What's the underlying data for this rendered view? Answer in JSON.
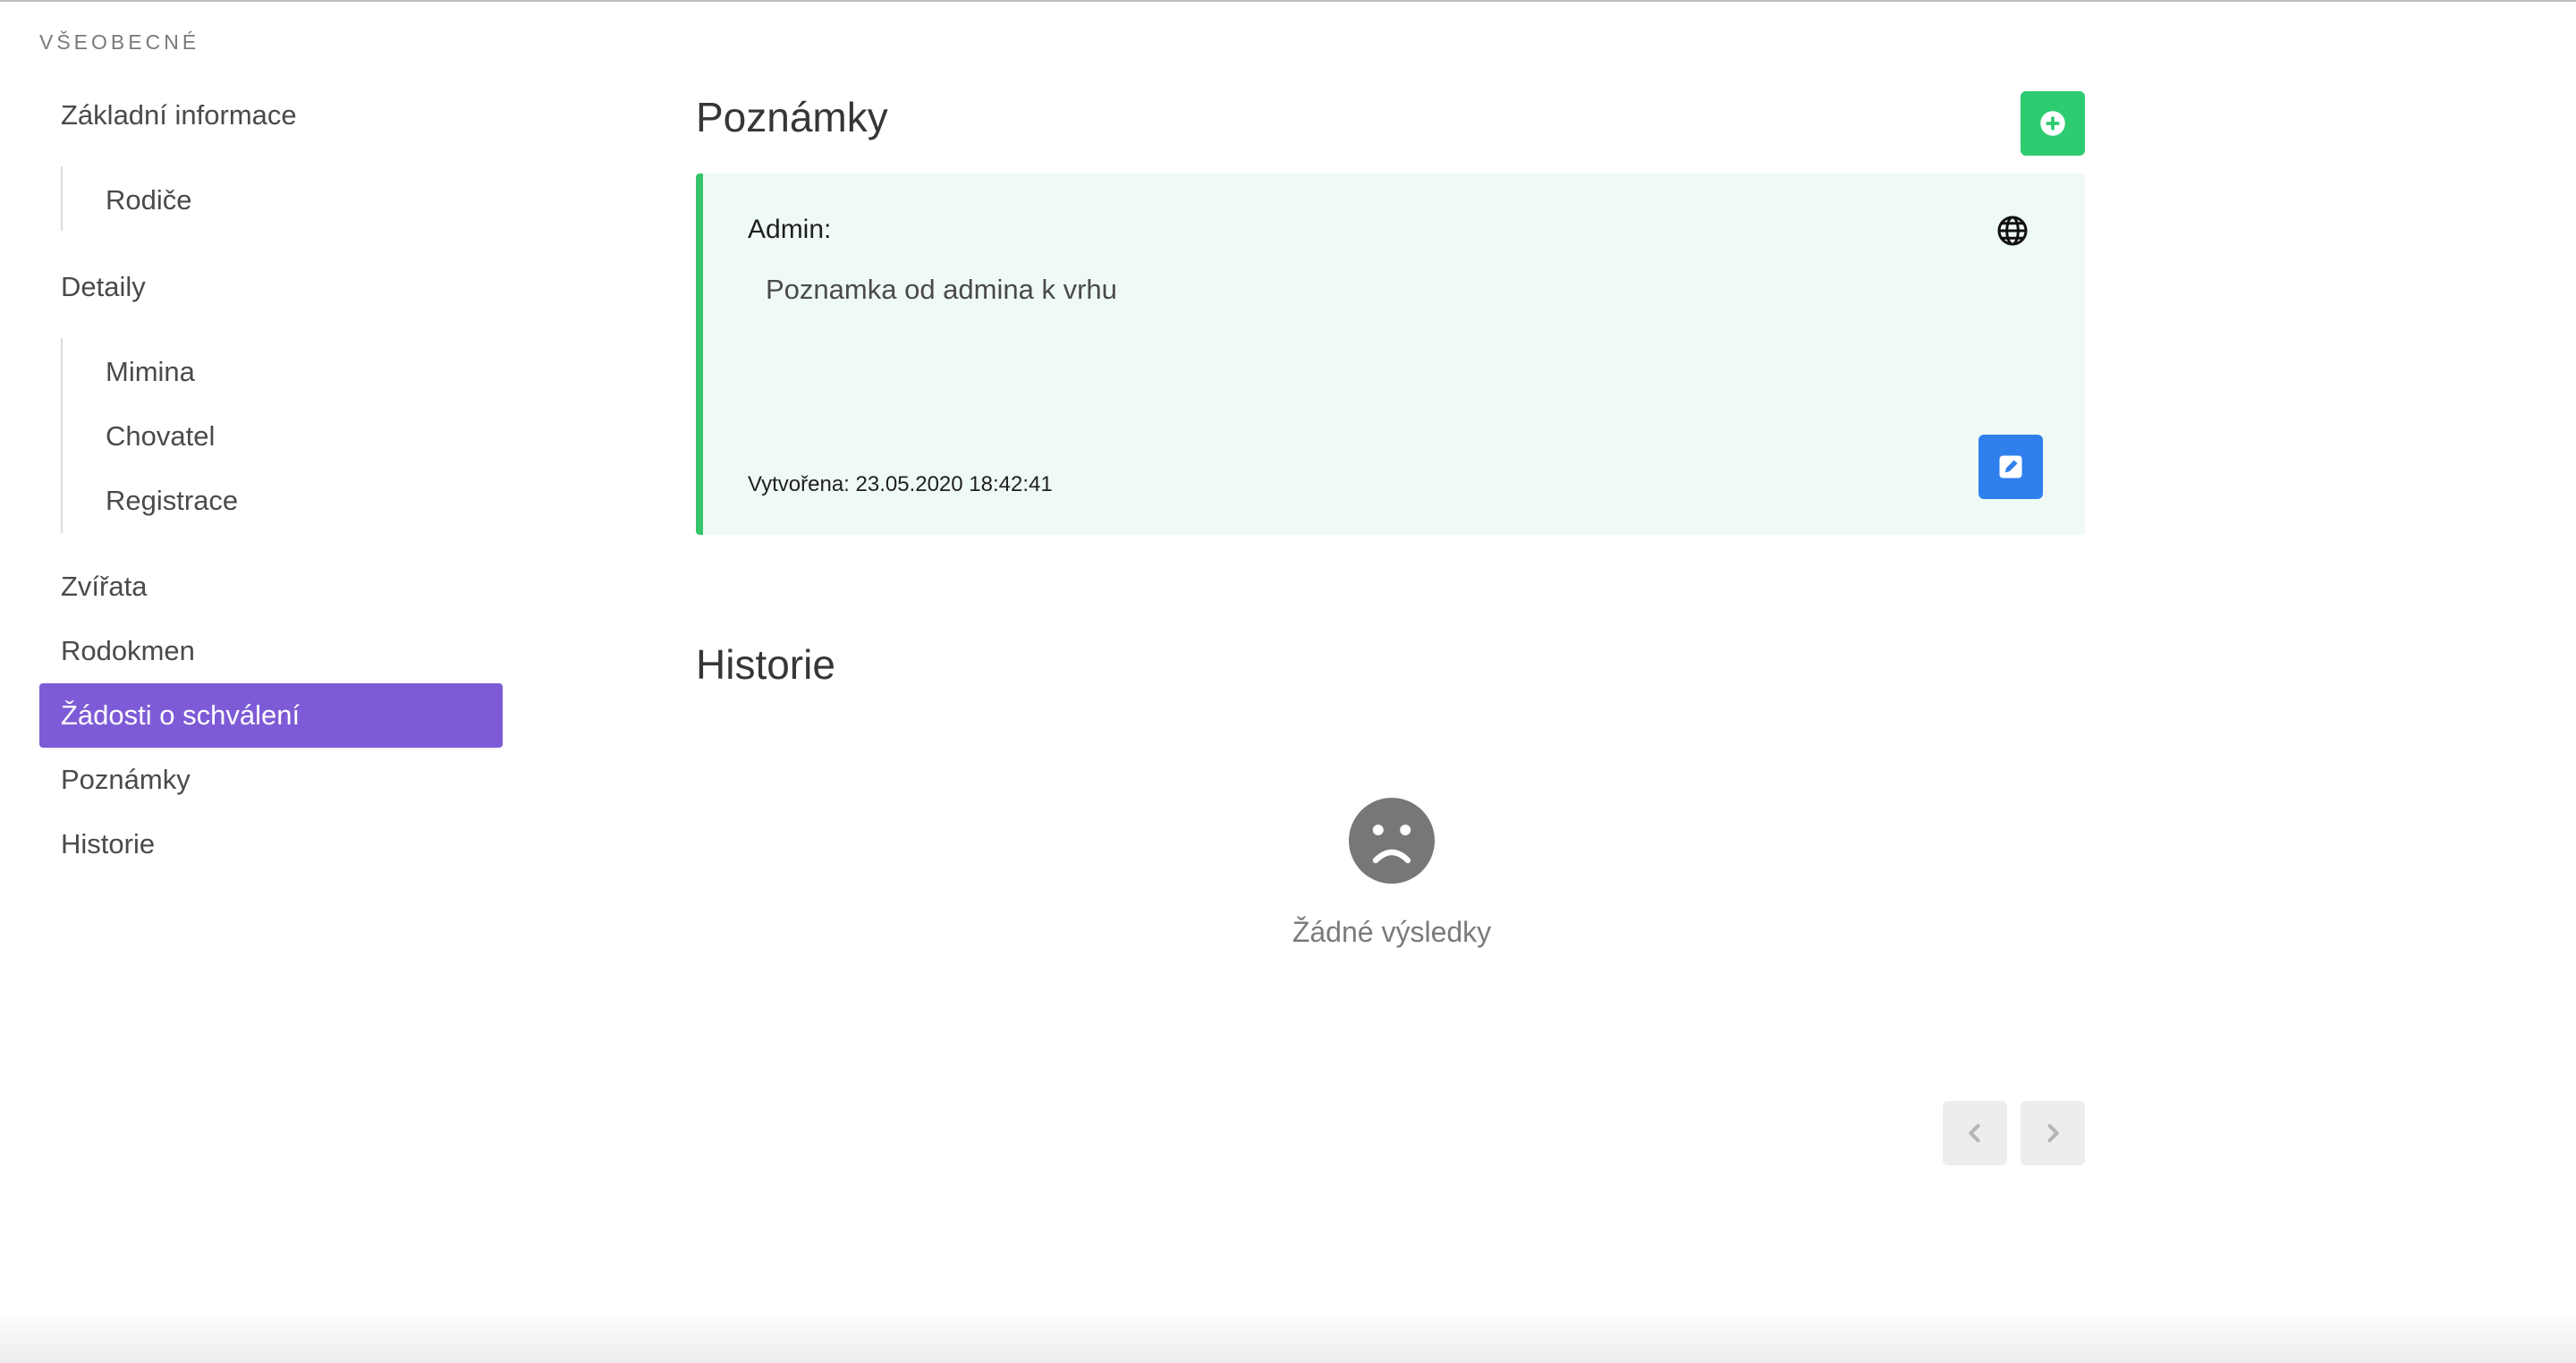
{
  "sidebar": {
    "section_label": "VŠEOBECNÉ",
    "items": [
      {
        "label": "Základní informace"
      },
      {
        "label": "Rodiče"
      },
      {
        "label": "Detaily"
      },
      {
        "label": "Mimina"
      },
      {
        "label": "Chovatel"
      },
      {
        "label": "Registrace"
      },
      {
        "label": "Zvířata"
      },
      {
        "label": "Rodokmen"
      },
      {
        "label": "Žádosti o schválení",
        "active": true
      },
      {
        "label": "Poznámky"
      },
      {
        "label": "Historie"
      }
    ]
  },
  "notes": {
    "title": "Poznámky",
    "add_icon": "plus-circle-icon",
    "items": [
      {
        "author": "Admin:",
        "visibility_icon": "globe-icon",
        "text": "Poznamka od admina k vrhu",
        "created": "Vytvořena: 23.05.2020 18:42:41",
        "edit_icon": "edit-icon"
      }
    ]
  },
  "history": {
    "title": "Historie",
    "empty_icon": "sad-face-icon",
    "empty_text": "Žádné výsledky",
    "pager": {
      "prev_icon": "chevron-left-icon",
      "next_icon": "chevron-right-icon"
    }
  },
  "colors": {
    "active_menu": "#7e5bd6",
    "add_button": "#2ecc71",
    "note_border": "#35c46a",
    "note_background": "#effaf4",
    "edit_button": "#2f80ed"
  }
}
